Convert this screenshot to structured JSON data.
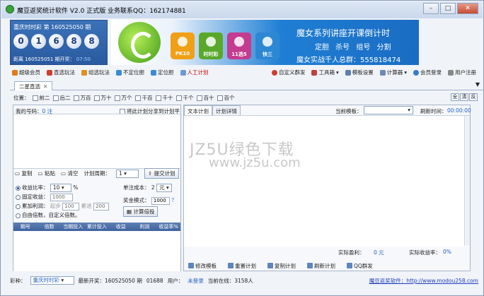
{
  "window": {
    "title": "魔豆返奖统计软件 V2.0 正式版  业务联系QQ：162174881"
  },
  "lottery": {
    "title": "重庆时时彩 第 160525050 期",
    "balls": [
      "0",
      "1",
      "6",
      "8",
      "8"
    ],
    "next_label": "距离 160525051 期开奖：",
    "next_time": "07:50"
  },
  "banner": {
    "headline": "魔女系列讲座开课倒计时",
    "subline": "定胆 杀号 组号 分割",
    "group_label": "魔女实战千人总群：555818474",
    "games": [
      "PK10",
      "时时彩",
      "11选5",
      "快三"
    ]
  },
  "toolbar": {
    "left": [
      "超级会员",
      "直选玩法",
      "组选玩法",
      "不定位胆",
      "定位胆",
      "人工计划"
    ],
    "right": [
      "自定义群发",
      "工具箱",
      "模板设置",
      "计算器",
      "会员登录",
      "用户注册"
    ]
  },
  "tab": {
    "label": "二星直选"
  },
  "positions": {
    "label": "位置：",
    "items": [
      "前二",
      "后二",
      "万百",
      "万十",
      "万个",
      "千百",
      "千十",
      "千个",
      "百十",
      "百个"
    ],
    "buttons": [
      "全",
      "清",
      "反"
    ]
  },
  "left": {
    "my_numbers": "我的号码：",
    "count": "0 注",
    "share": "将此计划分享到计划平台",
    "copy": "复制",
    "paste": "粘贴",
    "clear": "清空",
    "period_label": "计划周期：",
    "period_value": "1",
    "submit": "提交计划",
    "ratio_label": "收益比率：",
    "ratio_value": "10",
    "percent": "%",
    "unit_cost_label": "单注成本：",
    "unit_cost_value": "2",
    "unit": "元",
    "fixed_label": "固定收益：",
    "fixed_value": "1000",
    "prize_label": "奖金模式：",
    "prize_value": "1000",
    "accum_label": "累加利润：",
    "start_label": "起步",
    "start_value": "100",
    "add_label": "累进",
    "add_value": "200",
    "custom_label": "自由倍数，自定义倍数。",
    "calc_btn": "计算倍投",
    "grid_headers": [
      "期号",
      "倍数",
      "当期投入",
      "累计投入",
      "收益",
      "利润",
      "收益率%"
    ]
  },
  "right": {
    "tab_text": "文本计划",
    "tab_detail": "计划详情",
    "template_label": "当前模板：",
    "refresh_label": "刷新时间：",
    "refresh_time": "00:00:00",
    "watermark1": "JZ5U绿色下载",
    "watermark2": "www.jz5u.com",
    "actual_profit_label": "实际盈利：",
    "actual_profit_value": "0 元",
    "actual_rate_label": "实际收益率：",
    "actual_rate_value": "0%",
    "footer": [
      "修改模板",
      "重置计划",
      "复制计划",
      "刷新计划",
      "QQ群发"
    ]
  },
  "status": {
    "kind_label": "彩种：",
    "kind_value": "重庆时时彩",
    "latest_label": "最新开奖：160525050 期",
    "latest_value": "01688",
    "user_label": "用户：",
    "user_value": "未登录",
    "online_label": "当前在线：3158人",
    "link_label": "魔豆返奖软件：http://www.modou258.com"
  }
}
